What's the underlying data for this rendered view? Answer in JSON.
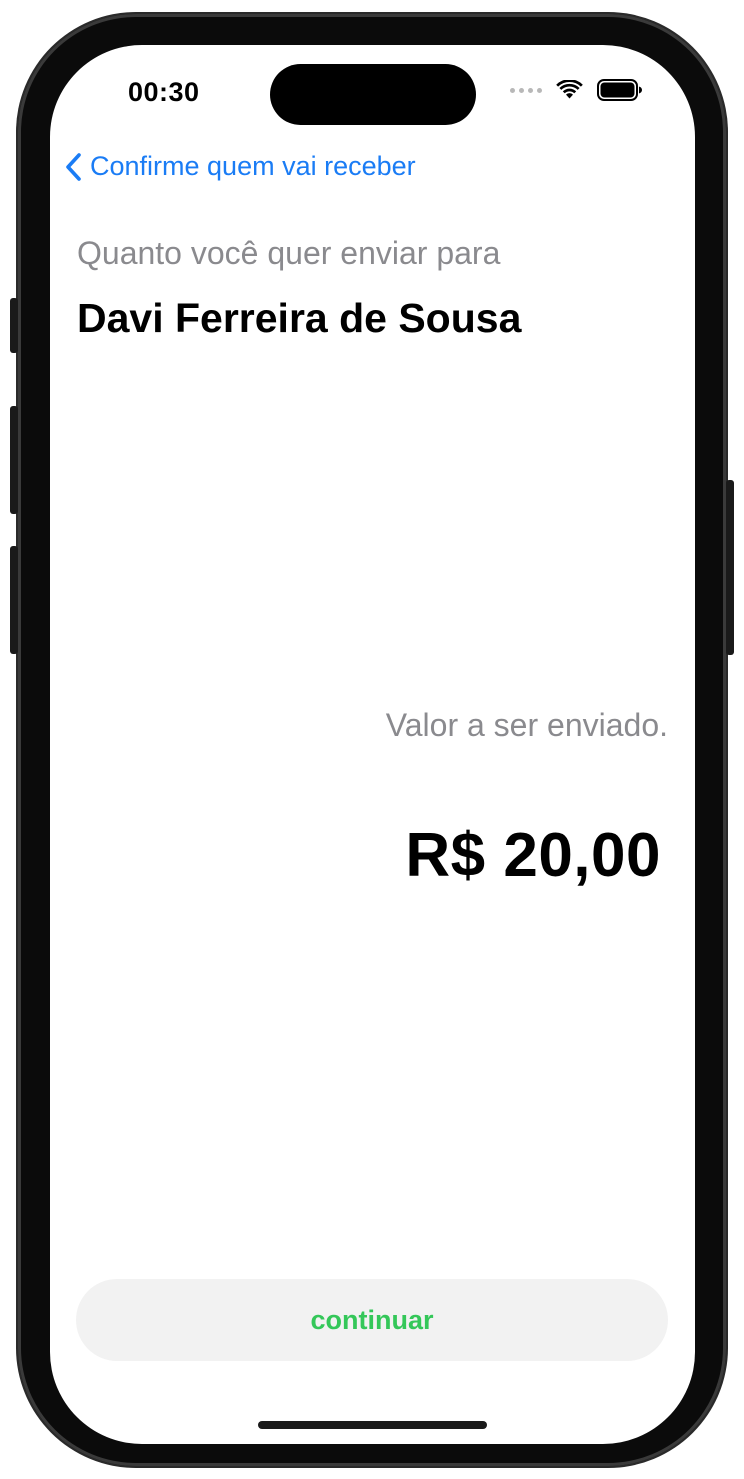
{
  "status_bar": {
    "time": "00:30",
    "icons": [
      "cellular-signal-icon",
      "wifi-icon",
      "battery-icon"
    ]
  },
  "nav": {
    "back_label": "Confirme quem vai receber",
    "back_icon": "chevron-left-icon"
  },
  "main": {
    "subtitle": "Quanto você quer enviar para",
    "recipient_name": "Davi Ferreira de Sousa",
    "amount_label": "Valor a ser enviado.",
    "amount_value": "R$ 20,00"
  },
  "footer": {
    "continue_label": "continuar"
  },
  "colors": {
    "accent_blue": "#1a7cf5",
    "continue_green": "#34c759",
    "secondary_text": "#8a8a8e",
    "button_background": "#f2f2f2"
  }
}
